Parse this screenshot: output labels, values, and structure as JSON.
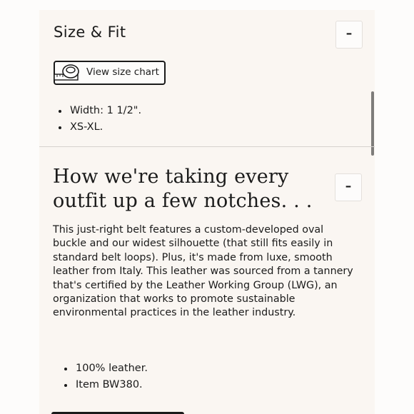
{
  "size_fit": {
    "title": "Size & Fit",
    "toggle_label": "–",
    "size_chart_button": "View size chart",
    "bullets": [
      "Width: 1 1/2\".",
      "XS-XL."
    ]
  },
  "details": {
    "heading": "How we're taking every outfit up a few notches. . .",
    "toggle_label": "–",
    "description": "This just-right belt features a custom-developed oval buckle and our widest silhouette (that still fits easily in standard belt loops). Plus, it's made from luxe, smooth leather from Italy. This leather was sourced from a tannery that's certified by the Leather Working Group (LWG), an organization that works to promote sustainable environmental practices in the leather industry.",
    "bullets": [
      "100% leather.",
      "Item BW380."
    ]
  },
  "icons": {
    "size_chart": "measuring-tape-icon"
  }
}
